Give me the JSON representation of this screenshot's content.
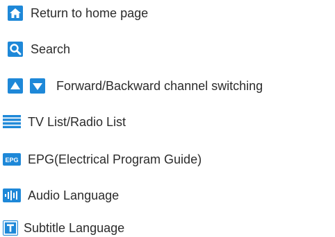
{
  "legend": {
    "items": [
      {
        "icon": "home-icon",
        "label": "Return to home page"
      },
      {
        "icon": "search-icon",
        "label": "Search"
      },
      {
        "icon": "up-down-arrow-icons",
        "label": "Forward/Backward channel switching"
      },
      {
        "icon": "list-icon",
        "label": "TV List/Radio List"
      },
      {
        "icon": "epg-icon",
        "icon_text": "EPG",
        "label": "EPG(Electrical Program Guide)"
      },
      {
        "icon": "audio-waveform-icon",
        "label": "Audio Language"
      },
      {
        "icon": "subtitle-t-icon",
        "label": "Subtitle Language"
      }
    ]
  },
  "colors": {
    "icon_blue": "#1e88d8",
    "icon_fg": "#ffffff",
    "text": "#2b2b2b"
  }
}
